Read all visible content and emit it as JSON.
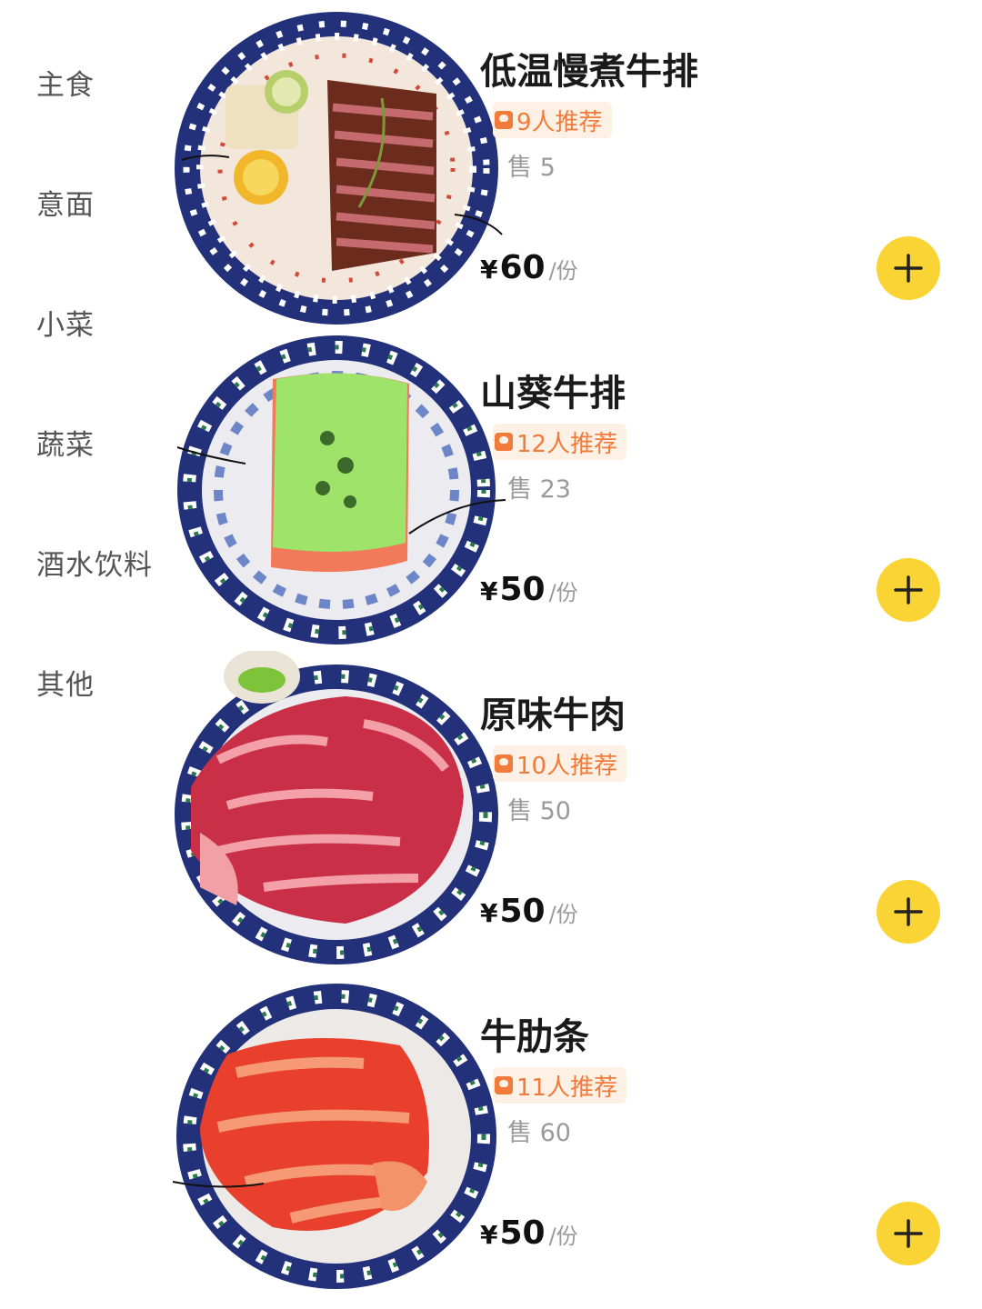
{
  "sidebar": {
    "categories": [
      {
        "label": "主食"
      },
      {
        "label": "意面"
      },
      {
        "label": "小菜"
      },
      {
        "label": "蔬菜"
      },
      {
        "label": "酒水饮料"
      },
      {
        "label": "其他"
      }
    ]
  },
  "dishes": [
    {
      "name": "低温慢煮牛排",
      "recommend": "9人推荐",
      "sold": "售 5",
      "price_symbol": "¥",
      "price": "60",
      "unit": "/份",
      "image": "steak-plate-illustration"
    },
    {
      "name": "山葵牛排",
      "recommend": "12人推荐",
      "sold": "售 23",
      "price_symbol": "¥",
      "price": "50",
      "unit": "/份",
      "image": "wasabi-steak-plate-illustration"
    },
    {
      "name": "原味牛肉",
      "recommend": "10人推荐",
      "sold": "售 50",
      "price_symbol": "¥",
      "price": "50",
      "unit": "/份",
      "image": "raw-beef-plate-illustration"
    },
    {
      "name": "牛肋条",
      "recommend": "11人推荐",
      "sold": "售 60",
      "price_symbol": "¥",
      "price": "50",
      "unit": "/份",
      "image": "beef-rib-plate-illustration"
    }
  ],
  "icons": {
    "add": "plus-icon",
    "recommend": "thumb-icon"
  },
  "colors": {
    "accent_yellow": "#fad335",
    "recommend_orange": "#f07b3a",
    "plate_blue": "#23307a"
  }
}
